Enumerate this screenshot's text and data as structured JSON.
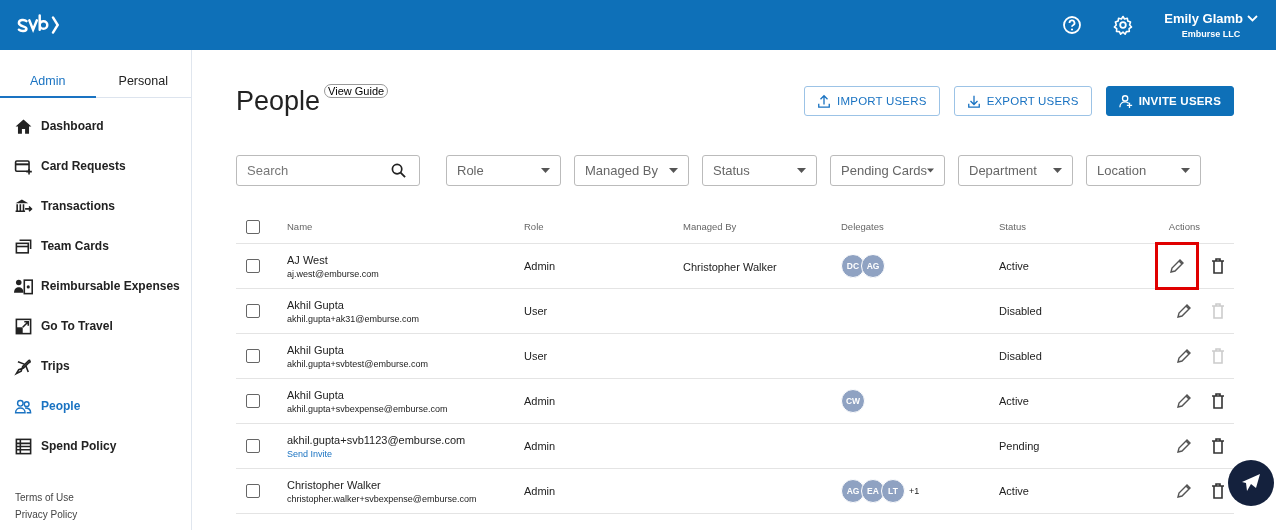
{
  "header": {
    "user_name": "Emily Glamb",
    "company": "Emburse LLC"
  },
  "sidebar": {
    "tabs": [
      {
        "label": "Admin",
        "selected": true
      },
      {
        "label": "Personal",
        "selected": false
      }
    ],
    "items": [
      {
        "label": "Dashboard",
        "selected": false
      },
      {
        "label": "Card Requests",
        "selected": false
      },
      {
        "label": "Transactions",
        "selected": false
      },
      {
        "label": "Team Cards",
        "selected": false
      },
      {
        "label": "Reimbursable Expenses",
        "selected": false
      },
      {
        "label": "Go To Travel",
        "selected": false
      },
      {
        "label": "Trips",
        "selected": false
      },
      {
        "label": "People",
        "selected": true
      },
      {
        "label": "Spend Policy",
        "selected": false
      }
    ],
    "footer_links": [
      "Terms of Use",
      "Privacy Policy"
    ]
  },
  "page": {
    "title": "People",
    "guide_button": "View Guide",
    "actions": [
      {
        "label": "IMPORT USERS",
        "kind": "outline"
      },
      {
        "label": "EXPORT USERS",
        "kind": "outline"
      },
      {
        "label": "INVITE USERS",
        "kind": "primary"
      }
    ]
  },
  "filters": {
    "search": {
      "placeholder": "Search"
    },
    "dropdowns": [
      "Role",
      "Managed By",
      "Status",
      "Pending Cards",
      "Department",
      "Location"
    ]
  },
  "table": {
    "columns": [
      "Name",
      "Role",
      "Managed By",
      "Delegates",
      "Status",
      "Actions"
    ],
    "all_checked": false,
    "rows": [
      {
        "name": "AJ West",
        "email": "aj.west@emburse.com",
        "role": "Admin",
        "managed_by": "Christopher Walker",
        "delegates": [
          "DC",
          "AG"
        ],
        "status": "Active",
        "checked": false,
        "delete_disabled": false,
        "edit_highlighted": true
      },
      {
        "name": "Akhil Gupta",
        "email": "akhil.gupta+ak31@emburse.com",
        "role": "User",
        "status": "Disabled",
        "checked": false,
        "delete_disabled": true,
        "edit_highlighted": false
      },
      {
        "name": "Akhil Gupta",
        "email": "akhil.gupta+svbtest@emburse.com",
        "role": "User",
        "status": "Disabled",
        "checked": false,
        "delete_disabled": true,
        "edit_highlighted": false
      },
      {
        "name": "Akhil Gupta",
        "email": "akhil.gupta+svbexpense@emburse.com",
        "role": "Admin",
        "delegates": [
          "CW"
        ],
        "status": "Active",
        "checked": false,
        "delete_disabled": false,
        "edit_highlighted": false
      },
      {
        "name": "akhil.gupta+svb1123@emburse.com",
        "action_link": "Send Invite",
        "role": "Admin",
        "status": "Pending",
        "checked": false,
        "delete_disabled": false,
        "edit_highlighted": false
      },
      {
        "name": "Christopher Walker",
        "email": "christopher.walker+svbexpense@emburse.com",
        "role": "Admin",
        "delegates": [
          "AG",
          "EA",
          "LT"
        ],
        "delegates_more": "+1",
        "status": "Active",
        "checked": false,
        "delete_disabled": false,
        "edit_highlighted": false
      }
    ]
  }
}
